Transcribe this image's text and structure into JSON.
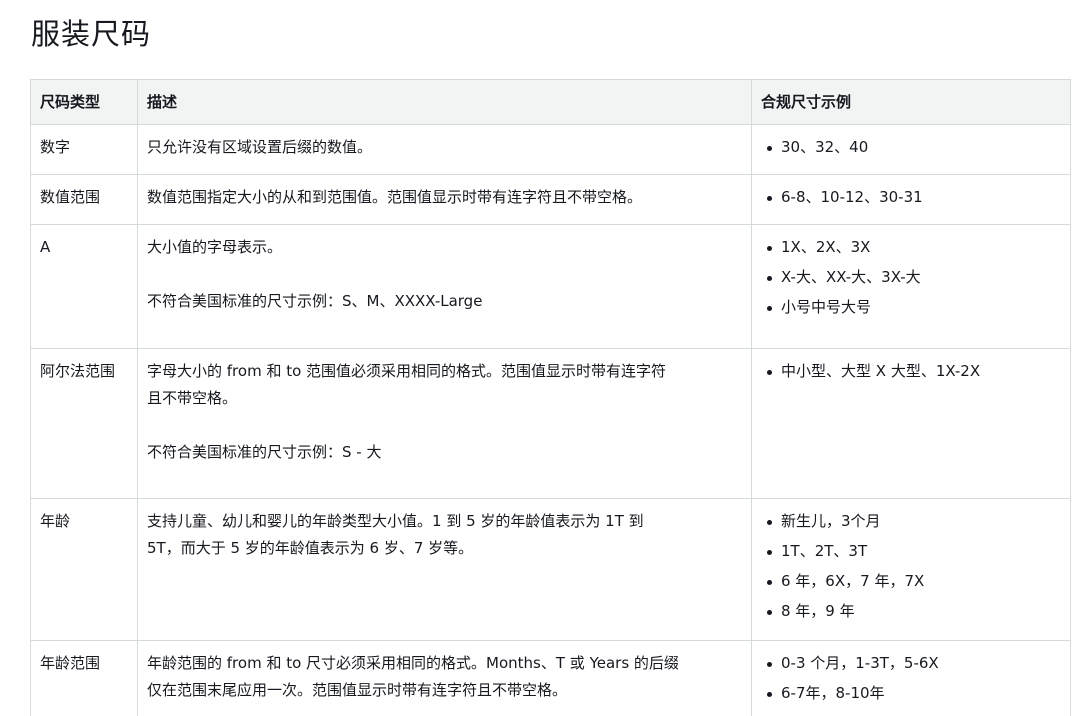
{
  "page": {
    "title": "服装尺码"
  },
  "table": {
    "headers": [
      "尺码类型",
      "描述",
      "合规尺寸示例"
    ],
    "rows": [
      {
        "type": "数字",
        "description": [
          "只允许没有区域设置后缀的数值。"
        ],
        "non_compliant": "",
        "examples": [
          "30、32、40"
        ]
      },
      {
        "type": "数值范围",
        "description": [
          "数值范围指定大小的从和到范围值。范围值显示时带有连字符且不带空格。"
        ],
        "non_compliant": "",
        "examples": [
          "6-8、10-12、30-31"
        ]
      },
      {
        "type": "A",
        "description": [
          "大小值的字母表示。"
        ],
        "non_compliant": "不符合美国标准的尺寸示例：S、M、XXXX-Large",
        "examples": [
          "1X、2X、3X",
          "X-大、XX-大、3X-大",
          "小号中号大号"
        ]
      },
      {
        "type": "阿尔法范围",
        "description": [
          "字母大小的 from 和 to 范围值必须采用相同的格式。范围值显示时带有连字符",
          "且不带空格。"
        ],
        "non_compliant": "不符合美国标准的尺寸示例：S - 大",
        "examples": [
          "中小型、大型 X 大型、1X-2X"
        ]
      },
      {
        "type": "年龄",
        "description": [
          "支持儿童、幼儿和婴儿的年龄类型大小值。1 到 5 岁的年龄值表示为 1T 到",
          "5T，而大于 5 岁的年龄值表示为 6 岁、7 岁等。"
        ],
        "non_compliant": "",
        "examples": [
          "新生儿，3个月",
          "1T、2T、3T",
          "6 年，6X，7 年，7X",
          "8 年，9 年"
        ]
      },
      {
        "type": "年龄范围",
        "description": [
          "年龄范围的 from 和 to 尺寸必须采用相同的格式。Months、T 或 Years 的后缀",
          "仅在范围末尾应用一次。范围值显示时带有连字符且不带空格。"
        ],
        "non_compliant": "",
        "examples": [
          "0-3 个月，1-3T，5-6X",
          "6-7年，8-10年"
        ]
      }
    ]
  }
}
